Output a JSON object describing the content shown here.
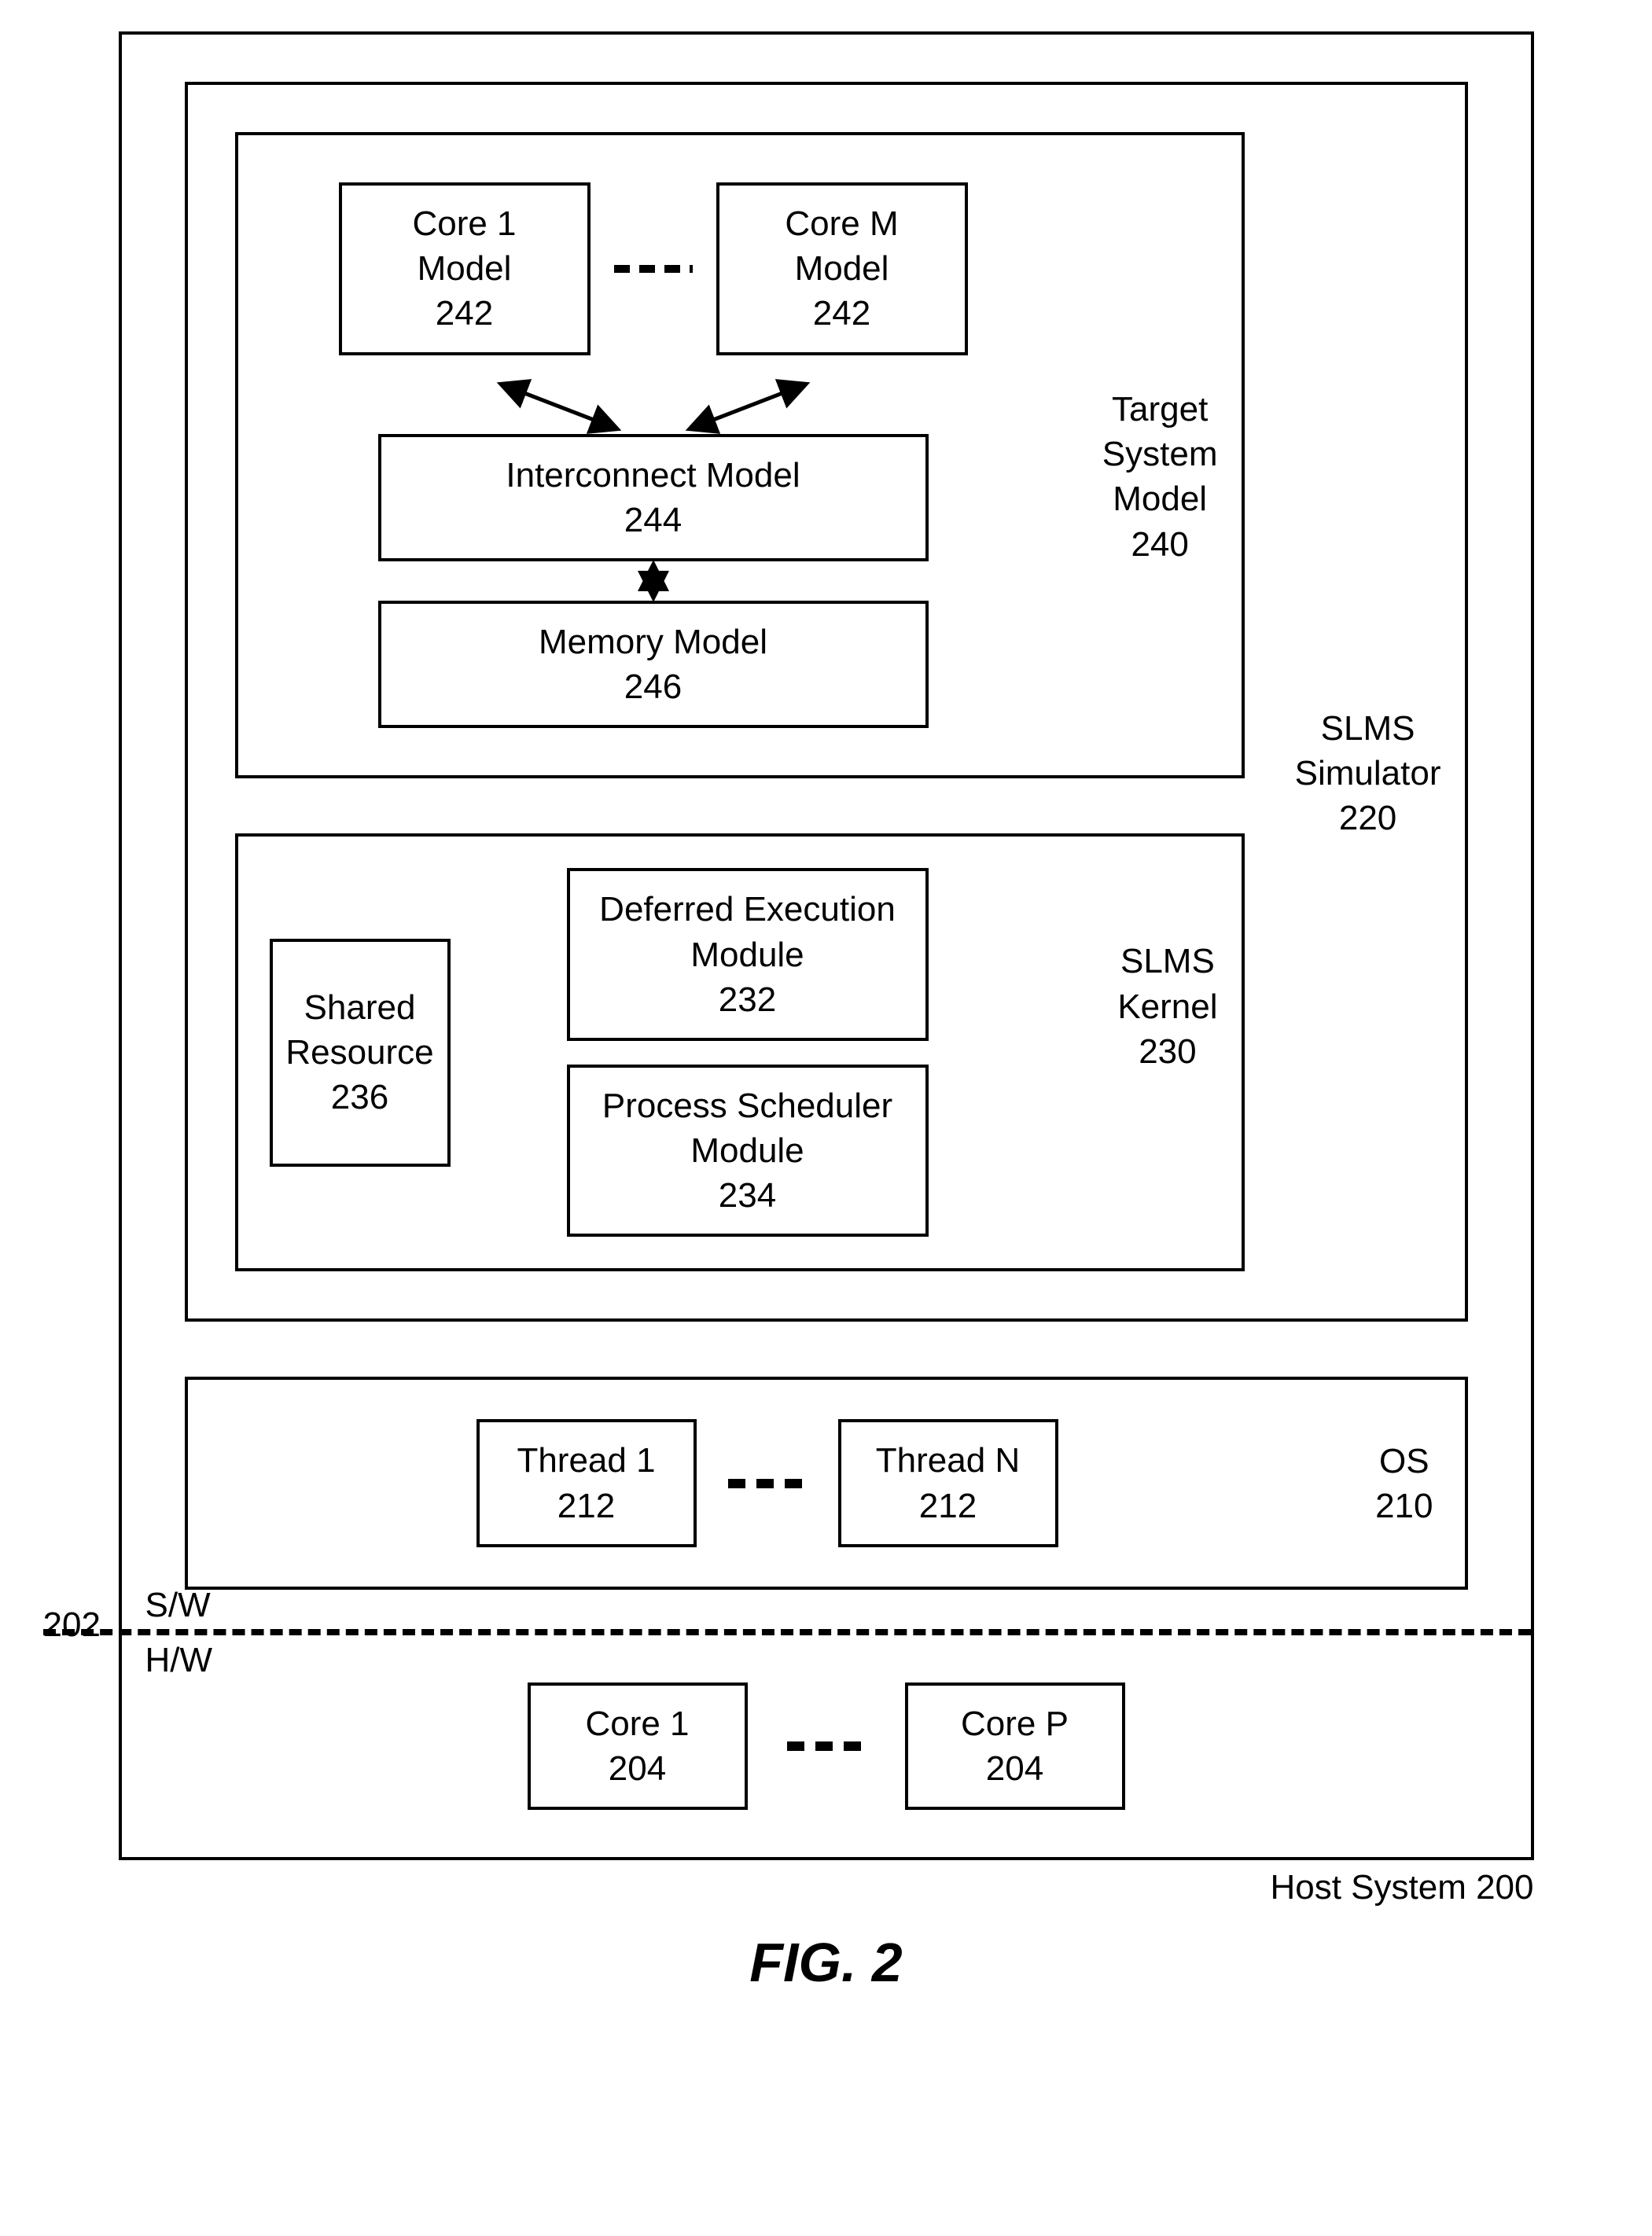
{
  "figure_label": "FIG. 2",
  "host_system": {
    "label": "Host System 200",
    "ref_202": "202",
    "sw_label": "S/W",
    "hw_label": "H/W",
    "cores": {
      "first": {
        "name": "Core 1",
        "num": "204"
      },
      "last": {
        "name": "Core P",
        "num": "204"
      }
    }
  },
  "os": {
    "label_name": "OS",
    "label_num": "210",
    "threads": {
      "first": {
        "name": "Thread 1",
        "num": "212"
      },
      "last": {
        "name": "Thread N",
        "num": "212"
      }
    }
  },
  "slms_simulator": {
    "label_name": "SLMS Simulator",
    "label_num": "220"
  },
  "target_system_model": {
    "label_name": "Target System Model",
    "label_num": "240",
    "cores": {
      "first": {
        "name": "Core 1 Model",
        "num": "242"
      },
      "last": {
        "name": "Core M Model",
        "num": "242"
      }
    },
    "interconnect": {
      "name": "Interconnect Model",
      "num": "244"
    },
    "memory": {
      "name": "Memory Model",
      "num": "246"
    }
  },
  "slms_kernel": {
    "label_name": "SLMS Kernel",
    "label_num": "230",
    "shared_resource": {
      "name": "Shared Resource",
      "num": "236"
    },
    "deferred_exec": {
      "name": "Deferred Execution Module",
      "num": "232"
    },
    "process_sched": {
      "name": "Process Scheduler Module",
      "num": "234"
    }
  },
  "ellipsis": "- - -"
}
